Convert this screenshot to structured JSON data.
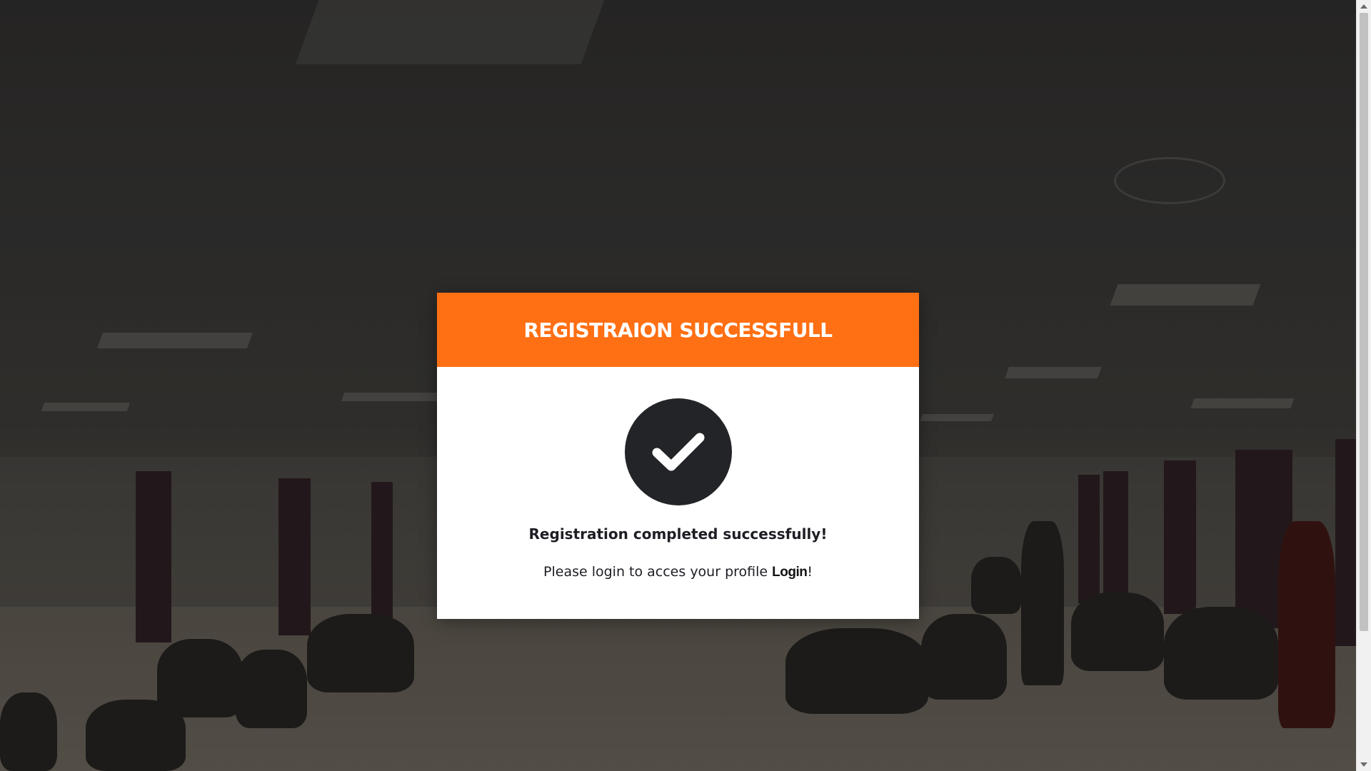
{
  "modal": {
    "title": "REGISTRAION SUCCESSFULL",
    "icon": "check-circle-icon",
    "message": "Registration completed successfully!",
    "login_prompt": "Please login to acces your profile ",
    "login_link": "Login",
    "login_suffix": "!"
  },
  "colors": {
    "header": "#ff6f13",
    "icon_circle": "#222428",
    "text": "#1d1d24"
  }
}
